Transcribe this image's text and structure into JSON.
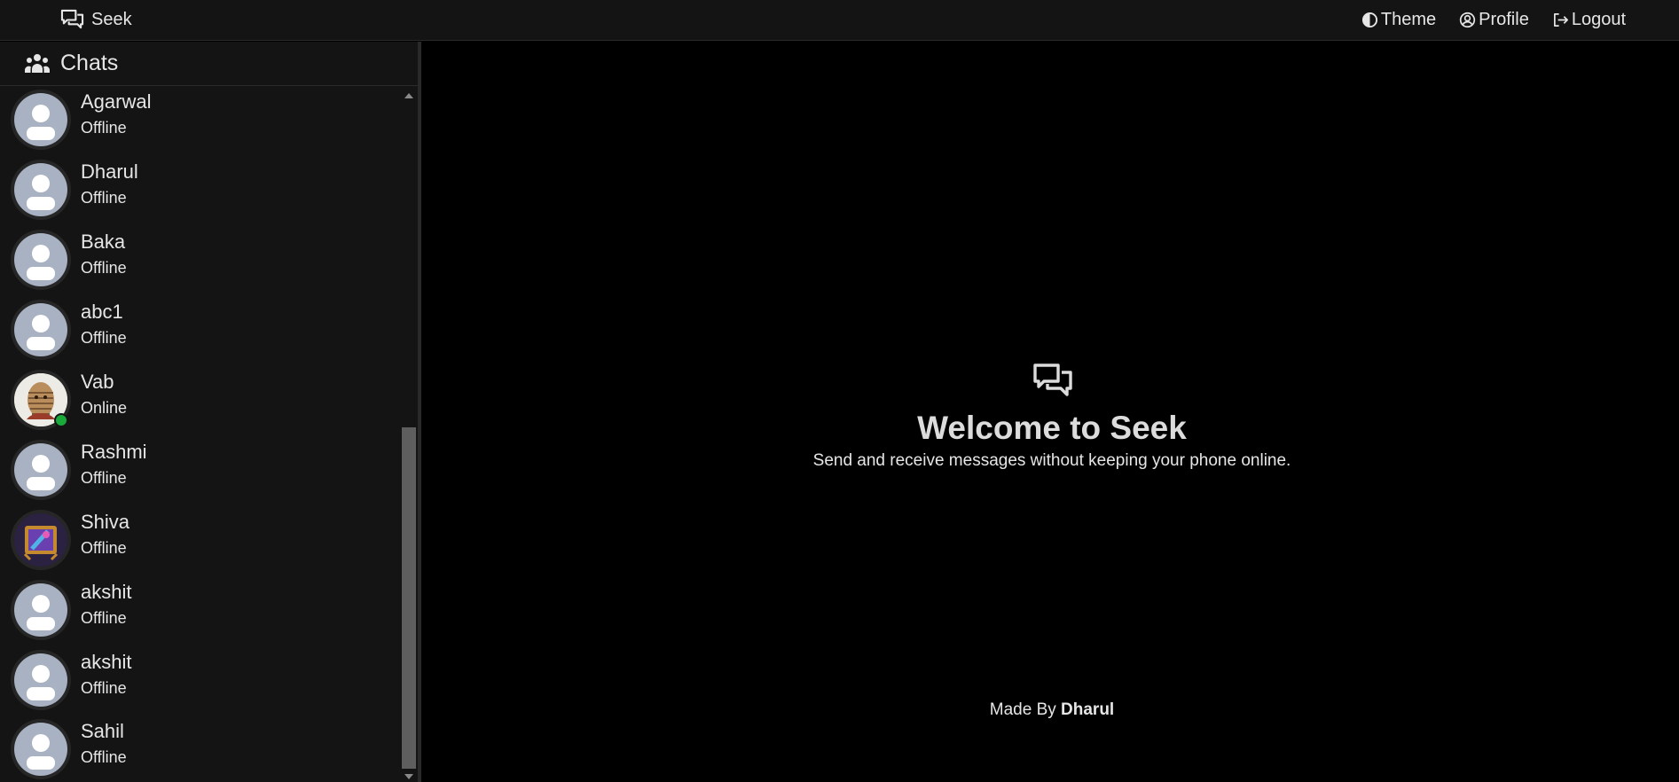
{
  "navbar": {
    "brand": "Seek",
    "brand_icon": "chat-bubbles-icon",
    "links": [
      {
        "label": "Theme",
        "icon": "contrast-icon"
      },
      {
        "label": "Profile",
        "icon": "user-circle-icon"
      },
      {
        "label": "Logout",
        "icon": "logout-icon"
      }
    ]
  },
  "sidebar": {
    "title": "Chats",
    "title_icon": "people-icon",
    "chats": [
      {
        "name": "Agarwal",
        "status": "Offline",
        "avatar": "default"
      },
      {
        "name": "Dharul",
        "status": "Offline",
        "avatar": "default"
      },
      {
        "name": "Baka",
        "status": "Offline",
        "avatar": "default"
      },
      {
        "name": "abc1",
        "status": "Offline",
        "avatar": "default"
      },
      {
        "name": "Vab",
        "status": "Online",
        "avatar": "photo-mummy"
      },
      {
        "name": "Rashmi",
        "status": "Offline",
        "avatar": "default"
      },
      {
        "name": "Shiva",
        "status": "Offline",
        "avatar": "photo-game-art"
      },
      {
        "name": "akshit",
        "status": "Offline",
        "avatar": "default"
      },
      {
        "name": "akshit",
        "status": "Offline",
        "avatar": "default"
      },
      {
        "name": "Sahil",
        "status": "Offline",
        "avatar": "default"
      }
    ]
  },
  "main": {
    "welcome_icon": "chat-bubbles-icon",
    "title": "Welcome to Seek",
    "subtitle": "Send and receive messages without keeping your phone online.",
    "footer_prefix": "Made By",
    "footer_author": "Dharul"
  },
  "colors": {
    "navbar_bg": "#141414",
    "sidebar_bg": "#141414",
    "main_bg": "#000000",
    "online": "#1aaa3c",
    "default_avatar": "#a8b2c2"
  }
}
